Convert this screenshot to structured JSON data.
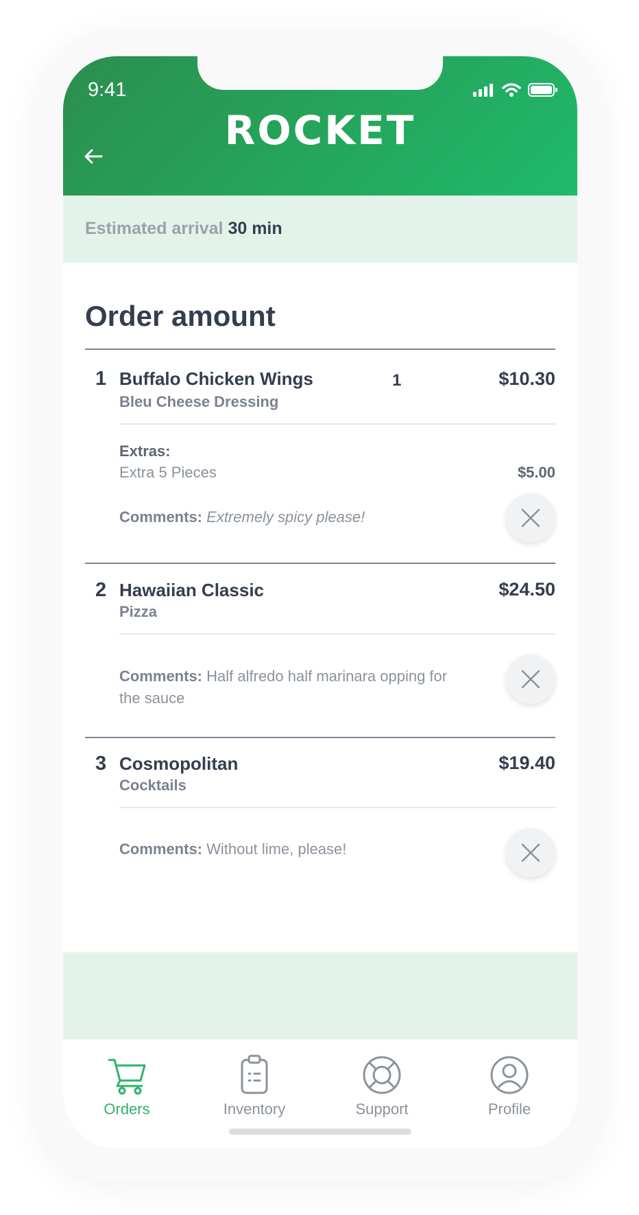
{
  "status_bar": {
    "time": "9:41"
  },
  "header": {
    "logo": "ROCKET",
    "back_icon": "arrow-left-icon"
  },
  "arrival": {
    "label": "Estimated arrival",
    "value": "30 min"
  },
  "order": {
    "title": "Order amount",
    "items": [
      {
        "number": "1",
        "name": "Buffalo Chicken Wings",
        "subtitle": "Bleu Cheese Dressing",
        "quantity": "1",
        "price": "$10.30",
        "extras_label": "Extras:",
        "extras_item": "Extra 5 Pieces",
        "extras_price": "$5.00",
        "comment_label": "Comments:",
        "comment_text": "Extremely spicy please!"
      },
      {
        "number": "2",
        "name": "Hawaiian Classic",
        "subtitle": "Pizza",
        "price": "$24.50",
        "comment_label": "Comments:",
        "comment_text": "Half alfredo half marinara opping for the sauce"
      },
      {
        "number": "3",
        "name": "Cosmopolitan",
        "subtitle": "Cocktails",
        "price": "$19.40",
        "comment_label": "Comments:",
        "comment_text": "Without lime, please!"
      }
    ]
  },
  "tabbar": {
    "tabs": [
      {
        "label": "Orders",
        "icon": "cart-icon",
        "active": true
      },
      {
        "label": "Inventory",
        "icon": "clipboard-icon",
        "active": false
      },
      {
        "label": "Support",
        "icon": "lifebuoy-icon",
        "active": false
      },
      {
        "label": "Profile",
        "icon": "user-circle-icon",
        "active": false
      }
    ]
  },
  "colors": {
    "brand_green_dark": "#2c8e4e",
    "brand_green_light": "#1fba6a",
    "tint_green": "#e4f3ea",
    "active_tab": "#2fb36b",
    "text_dark": "#353d4f",
    "text_muted": "#8b929c"
  }
}
